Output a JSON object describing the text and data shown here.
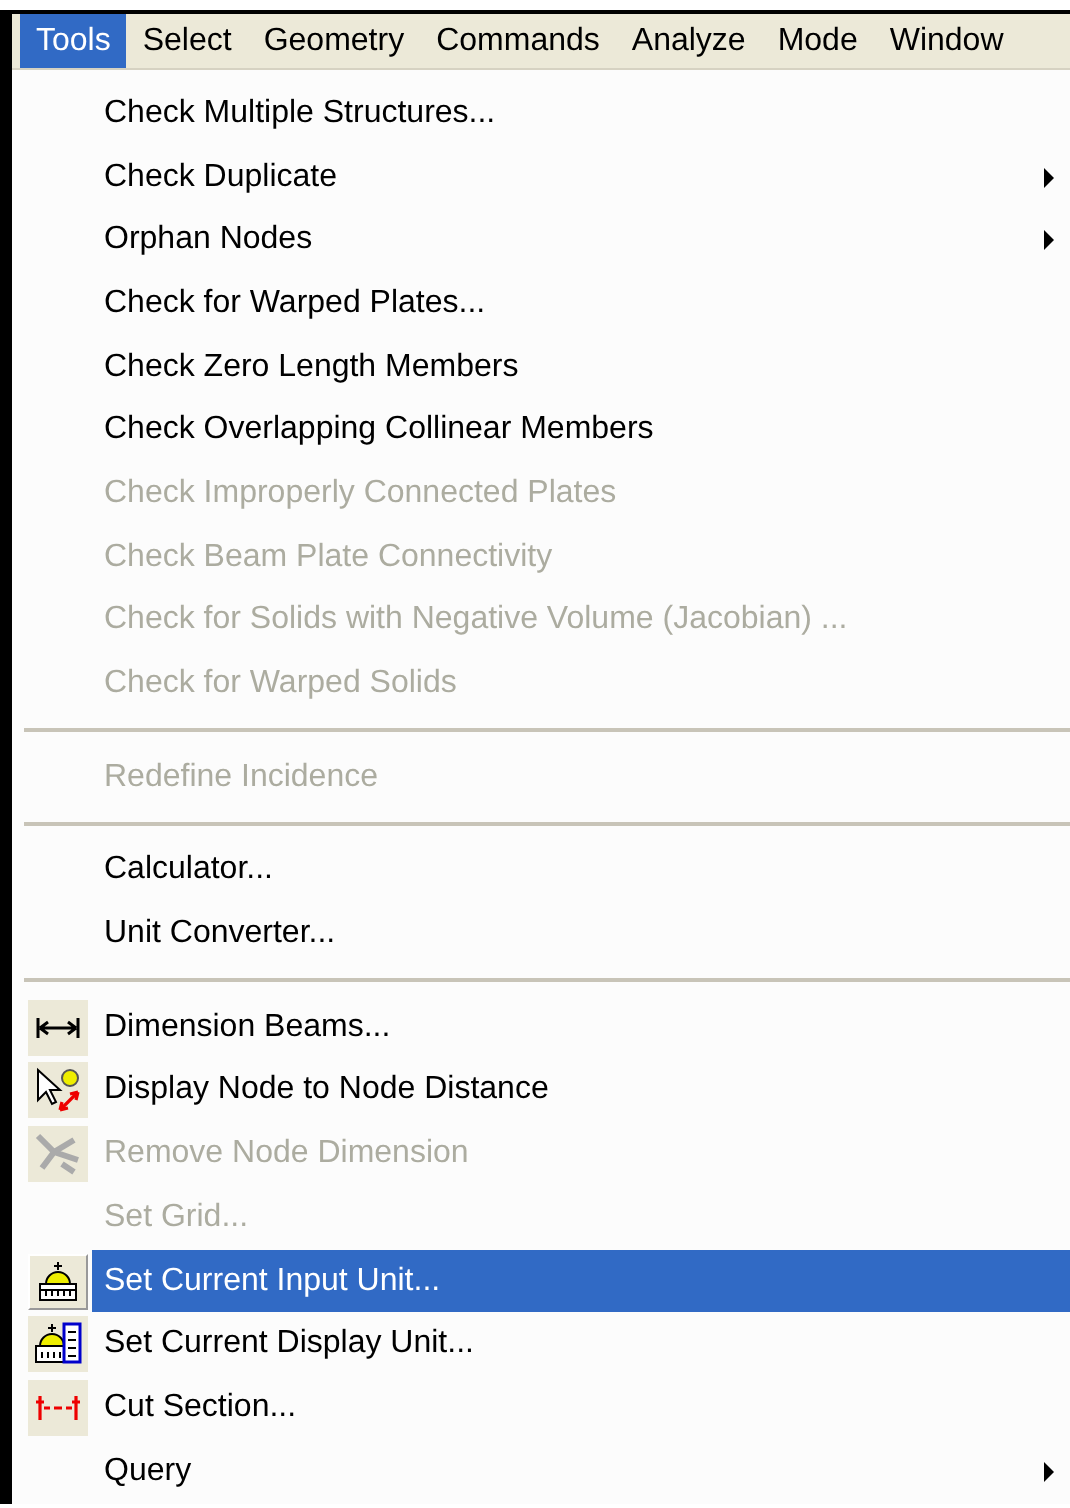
{
  "menubar": [
    {
      "label": "Tools",
      "selected": true
    },
    {
      "label": "Select",
      "selected": false
    },
    {
      "label": "Geometry",
      "selected": false
    },
    {
      "label": "Commands",
      "selected": false
    },
    {
      "label": "Analyze",
      "selected": false
    },
    {
      "label": "Mode",
      "selected": false
    },
    {
      "label": "Window",
      "selected": false
    }
  ],
  "menu_items": [
    {
      "kind": "item",
      "label": "Check Multiple Structures...",
      "disabled": false,
      "selected": false,
      "submenu": false
    },
    {
      "kind": "item",
      "label": "Check Duplicate",
      "disabled": false,
      "selected": false,
      "submenu": true
    },
    {
      "kind": "item",
      "label": "Orphan Nodes",
      "disabled": false,
      "selected": false,
      "submenu": true
    },
    {
      "kind": "item",
      "label": "Check for Warped Plates...",
      "disabled": false,
      "selected": false,
      "submenu": false
    },
    {
      "kind": "item",
      "label": "Check Zero Length Members",
      "disabled": false,
      "selected": false,
      "submenu": false
    },
    {
      "kind": "item",
      "label": "Check Overlapping Collinear Members",
      "disabled": false,
      "selected": false,
      "submenu": false
    },
    {
      "kind": "item",
      "label": "Check Improperly Connected Plates",
      "disabled": true,
      "selected": false,
      "submenu": false
    },
    {
      "kind": "item",
      "label": "Check Beam Plate Connectivity",
      "disabled": true,
      "selected": false,
      "submenu": false
    },
    {
      "kind": "item",
      "label": "Check for Solids with Negative Volume (Jacobian) ...",
      "disabled": true,
      "selected": false,
      "submenu": false
    },
    {
      "kind": "item",
      "label": "Check for Warped Solids",
      "disabled": true,
      "selected": false,
      "submenu": false
    },
    {
      "kind": "separator"
    },
    {
      "kind": "item",
      "label": "Redefine Incidence",
      "disabled": true,
      "selected": false,
      "submenu": false
    },
    {
      "kind": "separator"
    },
    {
      "kind": "item",
      "label": "Calculator...",
      "disabled": false,
      "selected": false,
      "submenu": false
    },
    {
      "kind": "item",
      "label": "Unit Converter...",
      "disabled": false,
      "selected": false,
      "submenu": false
    },
    {
      "kind": "separator"
    },
    {
      "kind": "icon_item",
      "label": "Dimension Beams...",
      "disabled": false,
      "selected": false,
      "submenu": false
    },
    {
      "kind": "icon_item",
      "label": "Display Node to Node Distance",
      "disabled": false,
      "selected": false,
      "submenu": false
    },
    {
      "kind": "icon_item",
      "label": "Remove Node Dimension",
      "disabled": true,
      "selected": false,
      "submenu": false
    },
    {
      "kind": "item",
      "label": "Set Grid...",
      "disabled": true,
      "selected": false,
      "submenu": false
    },
    {
      "kind": "icon_item",
      "label": "Set Current Input Unit...",
      "disabled": false,
      "selected": true,
      "submenu": false
    },
    {
      "kind": "icon_item",
      "label": "Set Current Display Unit...",
      "disabled": false,
      "selected": false,
      "submenu": false
    },
    {
      "kind": "icon_item",
      "label": "Cut Section...",
      "disabled": false,
      "selected": false,
      "submenu": false
    },
    {
      "kind": "item",
      "label": "Query",
      "disabled": false,
      "selected": false,
      "submenu": true
    }
  ]
}
